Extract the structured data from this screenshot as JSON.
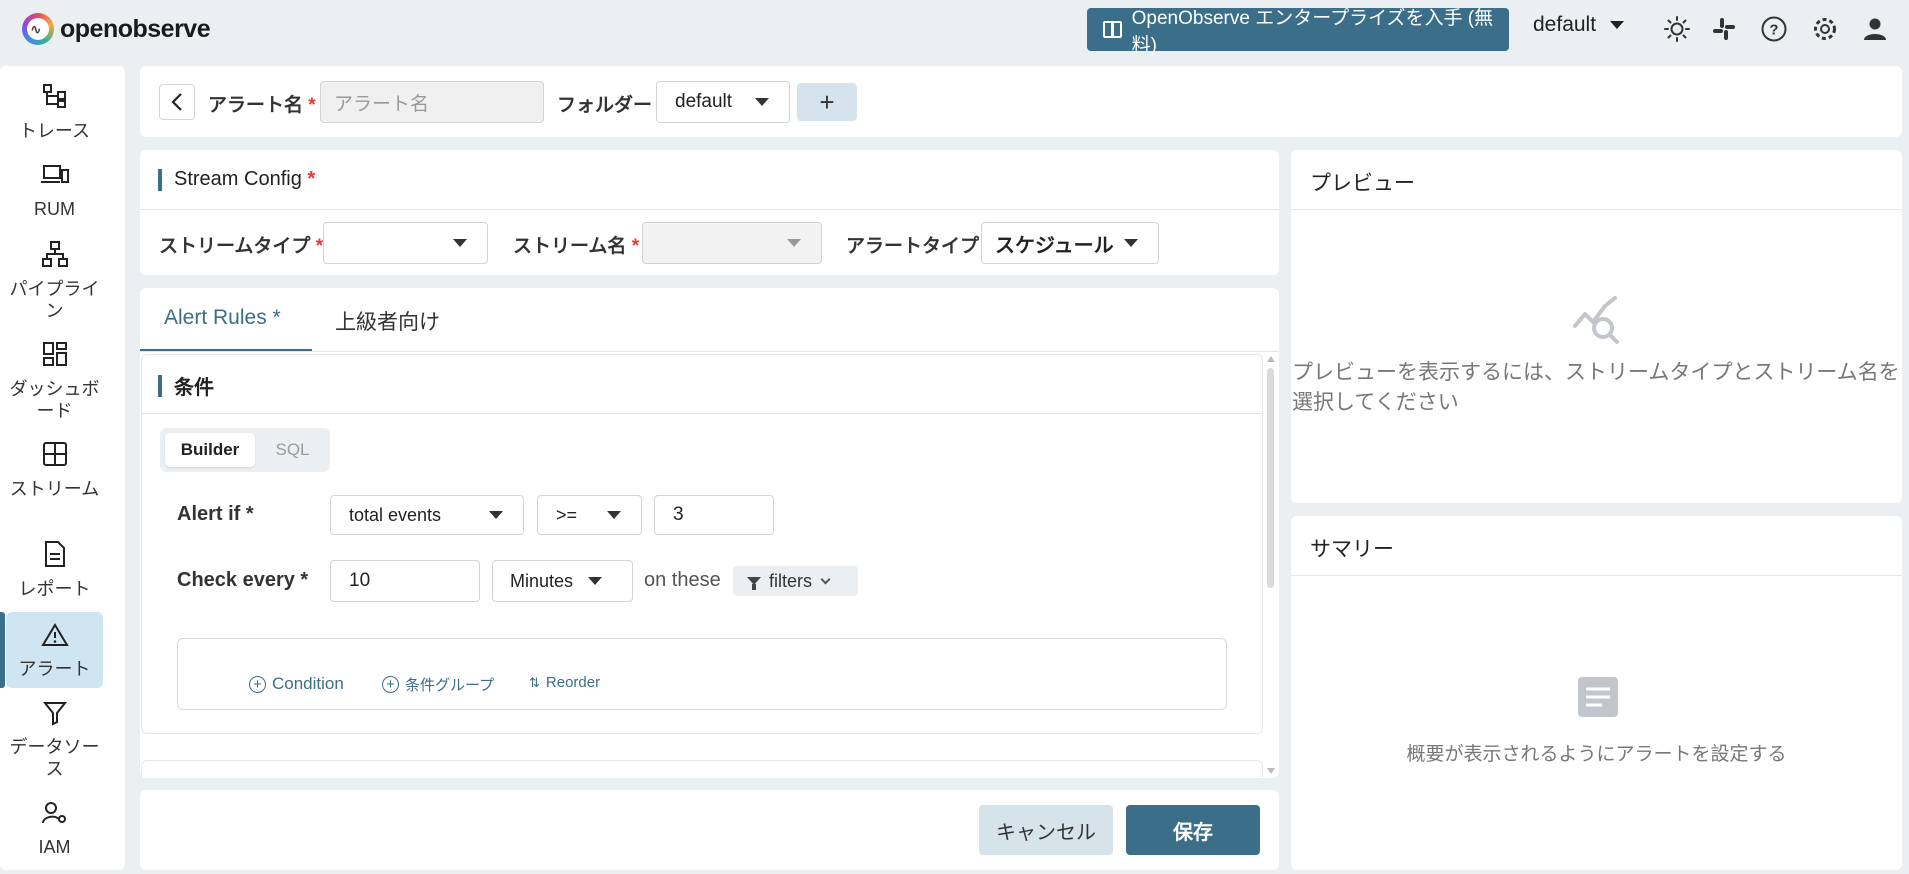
{
  "app": {
    "logo_text": "openobserve"
  },
  "header": {
    "enterprise_label": "OpenObserve エンタープライズを入手 (無料)",
    "org": "default"
  },
  "nav": [
    {
      "label": "トレース",
      "icon": "traces-icon"
    },
    {
      "label": "RUM",
      "icon": "rum-icon"
    },
    {
      "label": "パイプライン",
      "icon": "pipeline-icon"
    },
    {
      "label": "ダッシュボード",
      "icon": "dashboard-icon"
    },
    {
      "label": "ストリーム",
      "icon": "streams-icon"
    },
    {
      "label": "レポート",
      "icon": "report-icon"
    },
    {
      "label": "アラート",
      "icon": "alert-icon",
      "active": true
    },
    {
      "label": "データソース",
      "icon": "datasource-icon"
    },
    {
      "label": "IAM",
      "icon": "iam-icon"
    }
  ],
  "form": {
    "alert_name_label": "アラート名",
    "alert_name_placeholder": "アラート名",
    "folder_label": "フォルダー",
    "folder_value": "default",
    "add_label": "+"
  },
  "stream_config": {
    "title": "Stream Config",
    "stream_type_label": "ストリームタイプ",
    "stream_name_label": "ストリーム名",
    "alert_type_label": "アラートタイプ",
    "alert_type_value": "スケジュール"
  },
  "tabs": [
    "Alert Rules *",
    "上級者向け"
  ],
  "conditions": {
    "title": "条件",
    "mode_builder": "Builder",
    "mode_sql": "SQL",
    "alert_if_label": "Alert if *",
    "aggregate_value": "total events",
    "operator_value": ">=",
    "threshold_value": "3",
    "check_every_label": "Check every *",
    "interval_value": "10",
    "unit_value": "Minutes",
    "on_these": "on these",
    "filters_label": "filters",
    "add_condition": "Condition",
    "add_group": "条件グループ",
    "reorder": "Reorder"
  },
  "actions": {
    "cancel": "キャンセル",
    "save": "保存"
  },
  "preview": {
    "title": "プレビュー",
    "empty_line1": "プレビューを表示するには、ストリームタイプとストリーム名を",
    "empty_line2": "選択してください"
  },
  "summary": {
    "title": "サマリー",
    "empty": "概要が表示されるようにアラートを設定する"
  },
  "colors": {
    "accent": "#3b6e88",
    "required": "#e53935",
    "active_nav": "#cfe6f2"
  }
}
